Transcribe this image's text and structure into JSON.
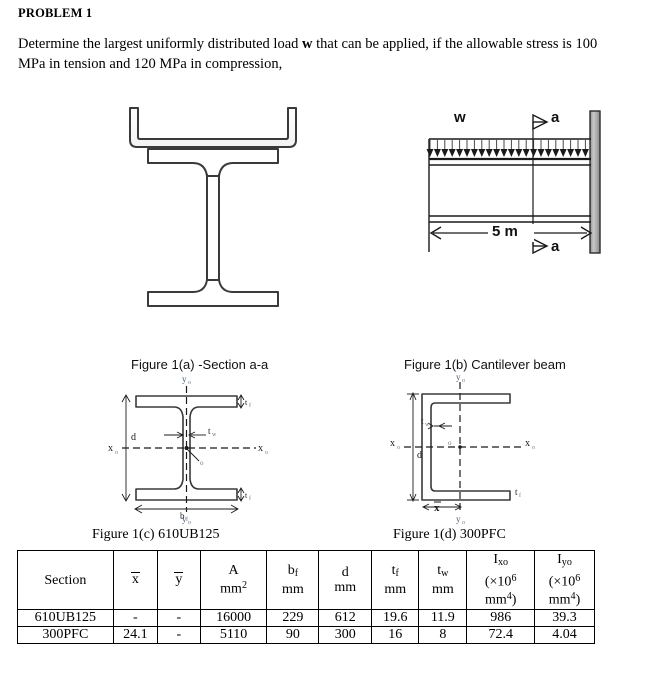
{
  "header": {
    "title": "PROBLEM 1",
    "statement_part1": "Determine the largest uniformly distributed load ",
    "statement_load_symbol": "w",
    "statement_part2": " that can be applied, if the allowable stress is 100 MPa in tension and 120 MPa in compression,"
  },
  "figures": {
    "section_caption": "Figure 1(a) -Section a-a",
    "beam_caption": "Figure 1(b) Cantilever beam",
    "ub_caption": "Figure 1(c) 610UB125",
    "pfc_caption": "Figure 1(d) 300PFC"
  },
  "beam_diagram": {
    "load_label": "w",
    "span_label": "5 m",
    "section_marker_top": "a",
    "section_marker_bottom": "a",
    "arrow_count": 22,
    "support_color": "#a8a8a8"
  },
  "ub_diagram": {
    "axis_x_left": "x",
    "axis_x_right": "x",
    "axis_y_top": "y",
    "axis_y_bottom": "y",
    "axis_subscript": "o",
    "centroid_label": "o",
    "depth_label": "d",
    "flange_width_label": "b",
    "flange_width_sub": "f",
    "flange_thickness_label": "t",
    "flange_thickness_sub": "f",
    "web_thickness_label": "t",
    "web_thickness_sub": "w"
  },
  "pfc_diagram": {
    "axis_x_left": "x",
    "axis_x_right": "x",
    "axis_y_top": "y",
    "axis_y_bottom": "y",
    "axis_subscript": "o",
    "centroid_label": "o",
    "depth_label": "d",
    "web_thickness_label": "t",
    "web_thickness_sub": "w",
    "flange_thickness_label": "t",
    "flange_thickness_sub": "f",
    "xbar_label": "x"
  },
  "table": {
    "headers": {
      "section": "Section",
      "xbar": "x",
      "ybar": "y",
      "area_symbol": "A",
      "area_unit": "mm",
      "area_unit_sup": "2",
      "bf_symbol": "b",
      "bf_sub": "f",
      "bf_unit": "mm",
      "d_symbol": "d",
      "d_unit": "mm",
      "tf_symbol": "t",
      "tf_sub": "f",
      "tf_unit": "mm",
      "tw_symbol": "t",
      "tw_sub": "w",
      "tw_unit": "mm",
      "ixo_symbol": "I",
      "ixo_sub": "xo",
      "ixo_unit_line1": "(×10",
      "ixo_unit_sup": "6",
      "ixo_unit_line2": "mm",
      "ixo_unit_sup2": "4",
      "ixo_unit_close": ")",
      "iyo_symbol": "I",
      "iyo_sub": "yo",
      "iyo_unit_line1": "(×10",
      "iyo_unit_sup": "6",
      "iyo_unit_line2": "mm",
      "iyo_unit_sup2": "4",
      "iyo_unit_close": ")"
    },
    "rows": [
      {
        "section": "610UB125",
        "xbar": "-",
        "ybar": "-",
        "area": "16000",
        "bf": "229",
        "d": "612",
        "tf": "19.6",
        "tw": "11.9",
        "ixo": "986",
        "iyo": "39.3"
      },
      {
        "section": "300PFC",
        "xbar": "24.1",
        "ybar": "-",
        "area": "5110",
        "bf": "90",
        "d": "300",
        "tf": "16",
        "tw": "8",
        "ixo": "72.4",
        "iyo": "4.04"
      }
    ]
  }
}
